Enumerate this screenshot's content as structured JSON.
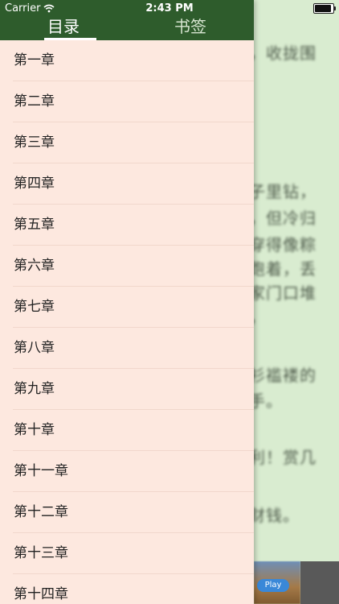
{
  "status_bar": {
    "carrier": "Carrier",
    "time": "2:43 PM"
  },
  "drawer": {
    "tabs": [
      {
        "label": "目录",
        "active": true
      },
      {
        "label": "书签",
        "active": false
      }
    ],
    "chapters": [
      "第一章",
      "第二章",
      "第三章",
      "第四章",
      "第五章",
      "第六章",
      "第七章",
      "第八章",
      "第九章",
      "第十章",
      "第十一章",
      "第十二章",
      "第十三章",
      "第十四章"
    ]
  },
  "reader": {
    "lines": [
      "，收拢围",
      "子里钻，",
      "，但冷归",
      "穿得像粽",
      "跑着，丢",
      "家门口堆",
      "，",
      "衫褴褛的",
      "手。",
      "利！赏几",
      "财钱。"
    ]
  },
  "ad": {
    "button_label": "Play"
  },
  "colors": {
    "header": "#2e5c2c",
    "drawer_bg": "#fde8df",
    "reader_bg": "#d9ecd0"
  }
}
